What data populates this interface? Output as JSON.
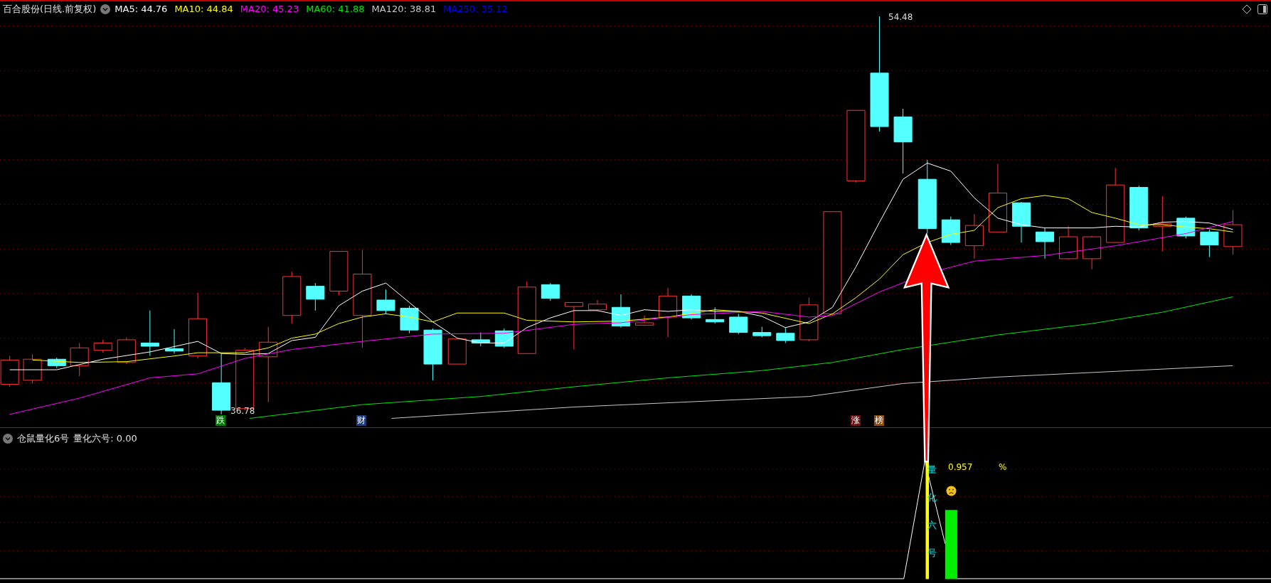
{
  "header": {
    "title": "百合股份(日线.前复权)",
    "indicators": [
      {
        "label": "MA5: 44.76",
        "color": "#ffffff"
      },
      {
        "label": "MA10: 44.84",
        "color": "#ffff00"
      },
      {
        "label": "MA20: 45.23",
        "color": "#ff00ff"
      },
      {
        "label": "MA60: 41.88",
        "color": "#00e600"
      },
      {
        "label": "MA120: 38.81",
        "color": "#c8c8c8"
      },
      {
        "label": "MA250: 35.12",
        "color": "#0000ff"
      }
    ]
  },
  "main_chart": {
    "high_label": "54.48",
    "low_label": "36.78",
    "markers": [
      {
        "text": "跌",
        "color": "#007a00"
      },
      {
        "text": "财",
        "color": "#1c3c78"
      },
      {
        "text": "涨",
        "color": "#6e0f0f"
      },
      {
        "text": "榜",
        "color": "#8a4a10"
      }
    ]
  },
  "sub_chart": {
    "title": "仓鼠量化6号",
    "reading": "量化六号: 0.00",
    "vertical_label": "量化六号",
    "value": "0.957",
    "unit": "%"
  }
}
